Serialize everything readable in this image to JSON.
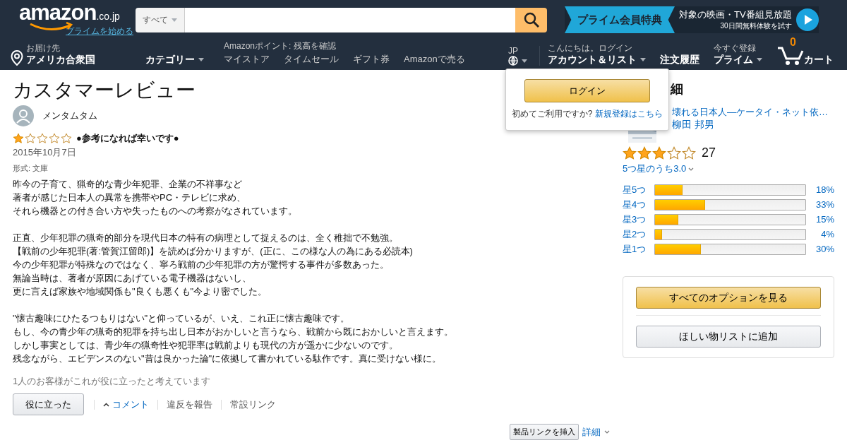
{
  "header": {
    "logo": {
      "text": "amazon",
      "suffix": ".co.jp",
      "link": "プライムを始める"
    },
    "search": {
      "category": "すべて"
    },
    "promo": {
      "badge": "プライム会員特典",
      "title": "対象の映画・TV番組見放題",
      "subtitle": "30日間無料体験を試す"
    },
    "deliver": {
      "label": "お届け先",
      "value": "アメリカ合衆国"
    },
    "category_menu": "カテゴリー",
    "points": "Amazonポイント: 残高を確認",
    "nav_links": [
      "マイストア",
      "タイムセール",
      "ギフト券",
      "Amazonで売る"
    ],
    "language": "JP",
    "account": {
      "greeting": "こんにちは。ログイン",
      "label": "アカウント＆リスト"
    },
    "orders": "注文履歴",
    "prime": {
      "small": "今すぐ登録",
      "label": "プライム"
    },
    "cart": {
      "count": "0",
      "label": "カート"
    }
  },
  "signin_popover": {
    "button": "ログイン",
    "prompt": "初めてご利用ですか?",
    "link": "新規登録はこちら"
  },
  "review": {
    "heading": "カスタマーレビュー",
    "author": "メンタムタム",
    "stars": 1,
    "title": "●参考になれば幸いです●",
    "date": "2015年10月7日",
    "format": "形式: 文庫",
    "paragraphs": [
      [
        "昨今の子育て、猟奇的な青少年犯罪、企業の不祥事など",
        "著者が感じた日本人の異常を携帯やPC・テレビに求め、",
        "それら機器との付き合い方や失ったものへの考察がなされています。"
      ],
      [
        "正直、少年犯罪の猟奇的部分を現代日本の特有の病理として捉えるのは、全く稚拙で不勉強。",
        "【戦前の少年犯罪(著:管賀江留郎)】を読めば分かりますが、(正に、この様な人の為にある必読本)",
        "今の少年犯罪が特殊なのではなく、寧ろ戦前の少年犯罪の方が驚愕する事件が多数あった。",
        "無論当時は、著者が原因にあげている電子機器はないし、",
        "更に言えば家族や地域関係も\"良くも悪くも\"今より密でした。"
      ],
      [
        "\"懐古趣味にひたるつもりはない\"と仰っているが、いえ、これ正に懐古趣味です。",
        "もし、今の青少年の猟奇的犯罪を持ち出し日本がおかしいと言うなら、戦前から既におかしいと言えます。",
        "しかし事実としては、青少年の猟奇性や犯罪率は戦前よりも現代の方が遥かに少ないのです。",
        "残念ながら、エビデンスのない\"昔は良かった論\"に依拠して書かれている駄作です。真に受けない様に。"
      ]
    ],
    "helpful_count": "1人のお客様がこれが役に立ったと考えています",
    "helpful_button": "役に立った",
    "comment": "コメント",
    "report": "違反を報告",
    "permalink": "常設リンク",
    "insert_link": "製品リンクを挿入",
    "details": "詳細"
  },
  "product": {
    "heading": "細",
    "title": "壊れる日本人―ケータイ・ネット依…",
    "author": "柳田 邦男",
    "stars": 3,
    "count": "27",
    "rating": "5つ星のうち3.0",
    "histogram": [
      {
        "label": "星5つ",
        "level": 0.18,
        "percent": "18%"
      },
      {
        "label": "星4つ",
        "level": 0.33,
        "percent": "33%"
      },
      {
        "label": "星3つ",
        "level": 0.15,
        "percent": "15%"
      },
      {
        "label": "星2つ",
        "level": 0.04,
        "percent": "4%"
      },
      {
        "label": "星1つ",
        "level": 0.3,
        "percent": "30%"
      }
    ],
    "options_button": "すべてのオプションを見る",
    "wishlist_button": "ほしい物リストに追加"
  }
}
